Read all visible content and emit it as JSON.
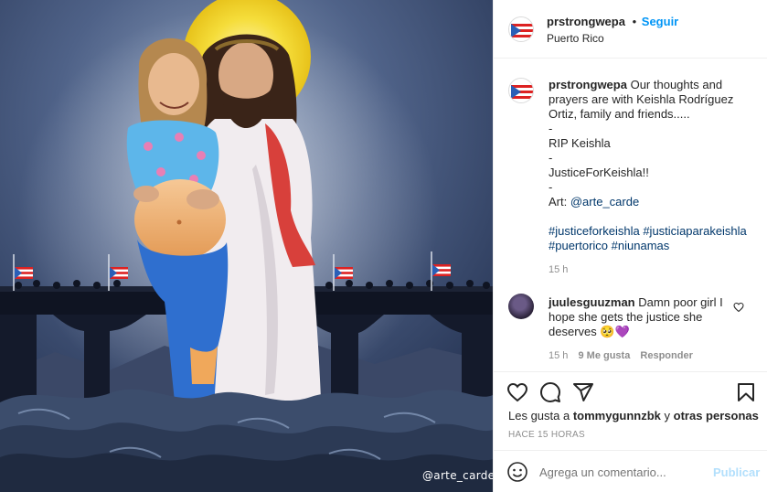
{
  "post": {
    "username": "prstrongwepa",
    "follow_separator": "•",
    "follow_label": "Seguir",
    "location": "Puerto Rico",
    "art_watermark": "@arte_carde"
  },
  "caption": {
    "username": "prstrongwepa",
    "lines": [
      "Our thoughts and prayers are with Keishla Rodríguez Ortiz, family and friends.....",
      "-",
      "RIP Keishla",
      "-",
      "JusticeForKeishla!!",
      "-",
      "Art:"
    ],
    "art_mention": "@arte_carde",
    "hashtags_line1": "#justiceforkeishla #justiciaparakeishla",
    "hashtags_line2": "#puertorico #niunamas",
    "time": "15 h"
  },
  "comment": {
    "username": "juulesguuzman",
    "text": "Damn poor girl I hope she gets the justice she deserves 🥺💜",
    "time": "15 h",
    "likes": "9 Me gusta",
    "reply_label": "Responder"
  },
  "likes": {
    "prefix": "Les gusta a",
    "user": "tommygunnzbk",
    "connector": "y",
    "others": "otras personas"
  },
  "posted_ago": "HACE 15 HORAS",
  "add_comment": {
    "placeholder": "Agrega un comentario...",
    "publish_label": "Publicar"
  },
  "icons": {
    "like": "heart-icon",
    "comment": "comment-icon",
    "share": "paper-plane-icon",
    "save": "bookmark-icon",
    "emoji": "emoji-icon",
    "comment_like": "small-heart-icon"
  },
  "colors": {
    "link": "#00376b",
    "follow": "#0095f6",
    "muted": "#8e8e8e",
    "publish_disabled": "#b2dffc",
    "halo": "#f2d51f"
  }
}
